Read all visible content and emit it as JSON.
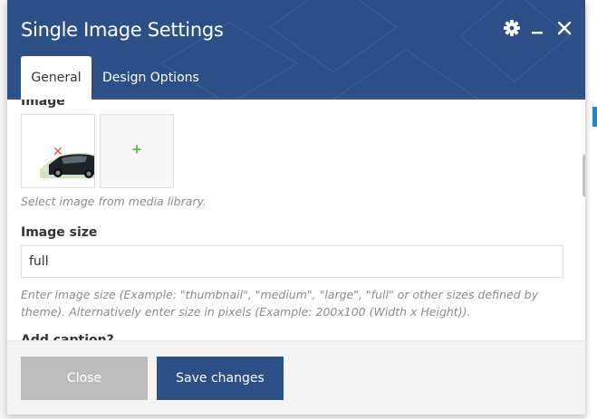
{
  "modal": {
    "title": "Single Image Settings",
    "tabs": [
      {
        "label": "General",
        "active": true
      },
      {
        "label": "Design Options",
        "active": false
      }
    ]
  },
  "general": {
    "image_label": "Image",
    "image_help": "Select image from media library.",
    "image_size_label": "Image size",
    "image_size_value": "full",
    "image_size_help_line1": "Enter image size (Example: \"thumbnail\", \"medium\", \"large\", \"full\" or other sizes defined by",
    "image_size_help_line2": "theme). Alternatively enter size in pixels (Example: 200x100 (Width x Height)).",
    "next_label_partial": "Add caption?"
  },
  "footer": {
    "close_label": "Close",
    "save_label": "Save changes"
  },
  "colors": {
    "header_bg": "#2c4f87",
    "save_button": "#2c4f87",
    "close_button": "#bcbcbc",
    "remove_icon": "#e04f4f",
    "add_icon": "#6cc04a"
  },
  "icons": {
    "settings": "gear-icon",
    "minimize": "minimize-icon",
    "close": "close-icon",
    "remove_image": "remove-x-icon",
    "add_image": "plus-icon"
  }
}
